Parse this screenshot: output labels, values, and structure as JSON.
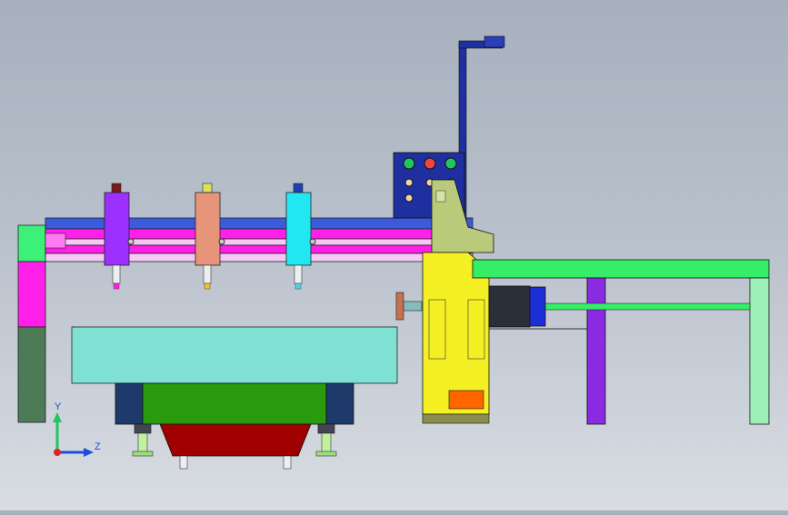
{
  "viewport": {
    "view": "front",
    "background_gradient": [
      "#a7b0bd",
      "#d9dde3"
    ]
  },
  "triad": {
    "y_label": "Y",
    "z_label": "Z",
    "colors": {
      "y": "#22c55e",
      "z": "#1d4ed8",
      "origin": "#dc2626"
    }
  },
  "machine": {
    "colors": {
      "beam_top": "#3b5bdb",
      "beam_magenta": "#ff1fe8",
      "beam_light": "#f5c9f2",
      "spindle_1": "#9b30ff",
      "spindle_2": "#e6957a",
      "spindle_3": "#22e6f0",
      "left_column_top": "#3cf07a",
      "left_column_mid": "#ff1fe8",
      "left_column_bottom": "#4d7a57",
      "table": "#7fe0d4",
      "carriage": "#2a9a0e",
      "carriage_ends": "#1d3a6a",
      "base": "#a10000",
      "control_panel": "#1f2fa0",
      "saw_body": "#f5f023",
      "saw_head": "#b9cb7a",
      "conveyor_frame": "#33ee66",
      "conveyor_leg_left": "#8a2be2",
      "conveyor_leg_right": "#9ff0b8",
      "motor": "#1c2fd6",
      "warning_label": "#ff6600"
    },
    "indicator_lights": [
      "#22c55e",
      "#ef4444",
      "#22c55e"
    ]
  }
}
